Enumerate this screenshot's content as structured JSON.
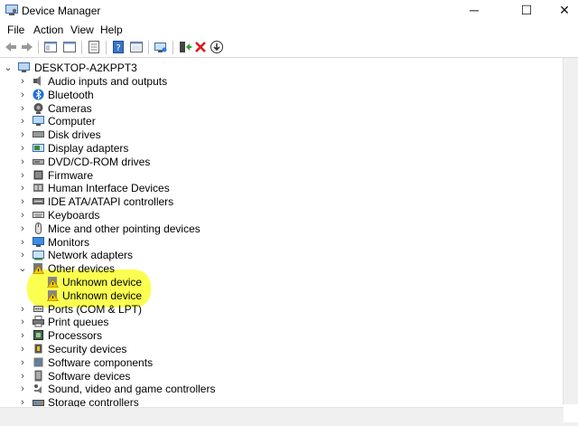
{
  "window": {
    "title": "Device Manager",
    "controls": {
      "minimize": "─",
      "maximize": "☐",
      "close": "✕"
    }
  },
  "menu": [
    "File",
    "Action",
    "View",
    "Help"
  ],
  "tree": {
    "root": "DESKTOP-A2KPPT3",
    "items": [
      {
        "label": "Audio inputs and outputs",
        "icon": "speaker-icon",
        "expanded": false
      },
      {
        "label": "Bluetooth",
        "icon": "bluetooth-icon",
        "expanded": false
      },
      {
        "label": "Cameras",
        "icon": "camera-icon",
        "expanded": false
      },
      {
        "label": "Computer",
        "icon": "computer-icon",
        "expanded": false
      },
      {
        "label": "Disk drives",
        "icon": "disk-drive-icon",
        "expanded": false
      },
      {
        "label": "Display adapters",
        "icon": "display-adapter-icon",
        "expanded": false
      },
      {
        "label": "DVD/CD-ROM drives",
        "icon": "dvd-drive-icon",
        "expanded": false
      },
      {
        "label": "Firmware",
        "icon": "firmware-icon",
        "expanded": false
      },
      {
        "label": "Human Interface Devices",
        "icon": "hid-icon",
        "expanded": false
      },
      {
        "label": "IDE ATA/ATAPI controllers",
        "icon": "ide-controller-icon",
        "expanded": false
      },
      {
        "label": "Keyboards",
        "icon": "keyboard-icon",
        "expanded": false
      },
      {
        "label": "Mice and other pointing devices",
        "icon": "mouse-icon",
        "expanded": false
      },
      {
        "label": "Monitors",
        "icon": "monitor-icon",
        "expanded": false
      },
      {
        "label": "Network adapters",
        "icon": "network-adapter-icon",
        "expanded": false
      },
      {
        "label": "Other devices",
        "icon": "other-devices-warning-icon",
        "expanded": true
      },
      {
        "label": "Unknown device",
        "icon": "unknown-device-warning-icon",
        "child": true
      },
      {
        "label": "Unknown device",
        "icon": "unknown-device-warning-icon",
        "child": true
      },
      {
        "label": "Ports (COM & LPT)",
        "icon": "port-icon",
        "expanded": false
      },
      {
        "label": "Print queues",
        "icon": "printer-icon",
        "expanded": false
      },
      {
        "label": "Processors",
        "icon": "processor-icon",
        "expanded": false
      },
      {
        "label": "Security devices",
        "icon": "security-device-icon",
        "expanded": false
      },
      {
        "label": "Software components",
        "icon": "software-component-icon",
        "expanded": false
      },
      {
        "label": "Software devices",
        "icon": "software-device-icon",
        "expanded": false
      },
      {
        "label": "Sound, video and game controllers",
        "icon": "sound-controller-icon",
        "expanded": false
      },
      {
        "label": "Storage controllers",
        "icon": "storage-controller-icon",
        "expanded": false
      }
    ]
  },
  "colors": {
    "highlight": "#fbff3d",
    "warning": "#f5c400",
    "blue_icon": "#2d7fd3"
  }
}
